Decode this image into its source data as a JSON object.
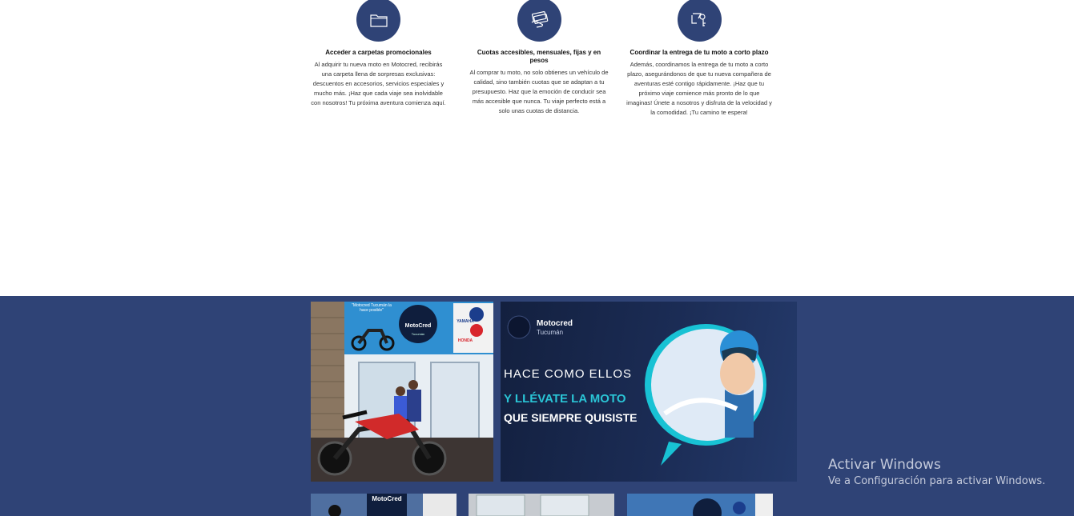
{
  "features": [
    {
      "icon": "folder-icon",
      "title": "Acceder a carpetas promocionales",
      "description": "Al adquirir tu nueva moto en Motocred, recibirás una carpeta llena de sorpresas exclusivas: descuentos en accesorios, servicios especiales y mucho más. ¡Haz que cada viaje sea inolvidable con nosotros! Tu próxima aventura comienza aquí."
    },
    {
      "icon": "money-hand-icon",
      "title": "Cuotas accesibles, mensuales, fijas y en pesos",
      "description": "Al comprar tu moto, no solo obtienes un vehículo de calidad, sino también cuotas que se adaptan a tu presupuesto. Haz que la emoción de conducir sea más accesible que nunca. Tu viaje perfecto está a solo unas cuotas de distancia."
    },
    {
      "icon": "key-hand-icon",
      "title": "Coordinar la entrega de tu moto a corto plazo",
      "description": "Además, coordinamos la entrega de tu moto a corto plazo, asegurándonos de que tu nueva compañera de aventuras esté contigo rápidamente. ¡Haz que tu próximo viaje comience más pronto de lo que imaginas! Únete a nosotros y disfruta de la velocidad y la comodidad. ¡Tu camino te espera!"
    }
  ],
  "gallery": {
    "store_photo": {
      "sign_slogan": "\"Motocred Tucumán la hace posible\"",
      "sign_brand": "MotoCred",
      "sign_city": "Tucumán",
      "sign_yamaha": "YAMAHA",
      "sign_honda": "HONDA"
    },
    "promo": {
      "brand": "Motocred",
      "brand_sub": "Tucumán",
      "line1": "HACE COMO ELLOS",
      "line2": "Y LLÉVATE LA MOTO",
      "line3": "QUE SIEMPRE QUISISTE"
    },
    "thumb_brand": "MotoCred"
  },
  "watermark": {
    "title": "Activar Windows",
    "subtitle": "Ve a Configuración para activar Windows."
  },
  "colors": {
    "accent": "#2f4376",
    "cyan": "#2ac5d6"
  }
}
